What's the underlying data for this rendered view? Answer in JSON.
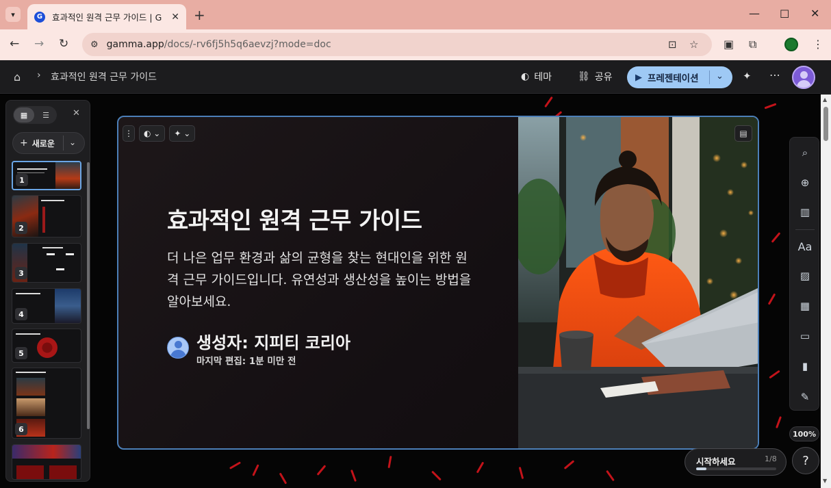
{
  "browser": {
    "tab_title": "효과적인 원격 근무 가이드 | G",
    "favicon_letter": "G",
    "url_host": "gamma.app",
    "url_path": "/docs/-rv6fj5h5q6aevzj?mode=doc"
  },
  "header": {
    "breadcrumb_title": "효과적인 원격 근무 가이드",
    "theme_label": "테마",
    "share_label": "공유",
    "present_label": "프레젠테이션"
  },
  "sidebar": {
    "new_label": "새로운",
    "slides": [
      {
        "number": "1"
      },
      {
        "number": "2"
      },
      {
        "number": "3"
      },
      {
        "number": "4"
      },
      {
        "number": "5"
      },
      {
        "number": "6"
      }
    ]
  },
  "slide": {
    "title": "효과적인 원격 근무 가이드",
    "description": "더 나은 업무 환경과 삶의 균형을 찾는 현대인을 위한 원격 근무 가이드입니다. 유연성과 생산성을 높이는 방법을 알아보세요.",
    "author": "생성자: 지피티 코리아",
    "last_edited": "마지막 편집: 1분 미만 전"
  },
  "zoom": "100%",
  "get_started": {
    "label": "시작하세요",
    "progress_text": "1/8",
    "progress_fraction": 0.125
  },
  "help_label": "?",
  "colors": {
    "accent_blue": "#9ec9f5",
    "card_border": "#4c7fb8",
    "streak_red": "#c3131a"
  }
}
